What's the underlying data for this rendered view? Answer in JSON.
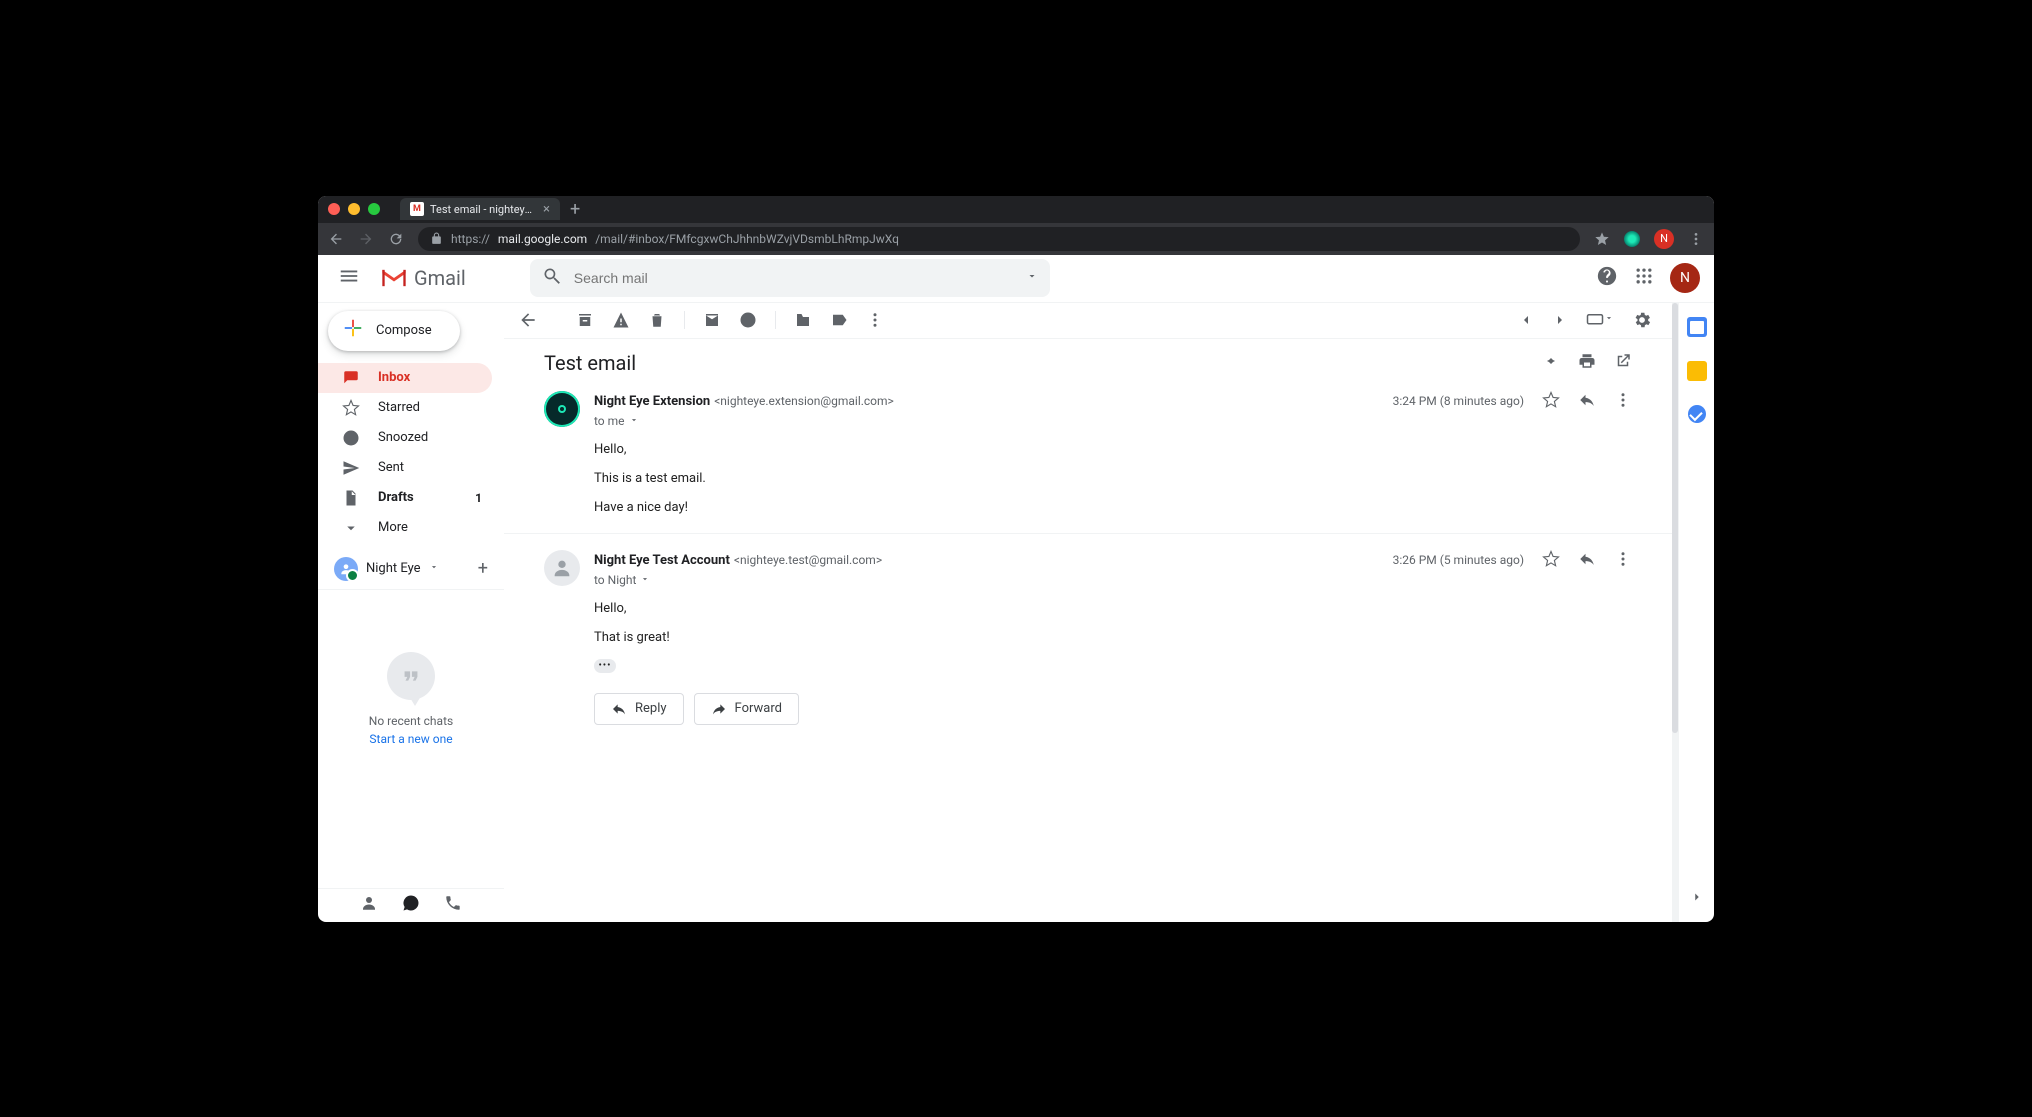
{
  "browser": {
    "tab_title": "Test email - nighteye.test@gm…",
    "url_proto": "https://",
    "url_host": "mail.google.com",
    "url_path": "/mail/#inbox/FMfcgxwChJhhnbWZvjVDsmbLhRmpJwXq",
    "avatar_letter": "N"
  },
  "header": {
    "product": "Gmail",
    "search_placeholder": "Search mail",
    "account_letter": "N"
  },
  "sidebar": {
    "compose": "Compose",
    "items": [
      {
        "label": "Inbox",
        "icon": "inbox"
      },
      {
        "label": "Starred",
        "icon": "star"
      },
      {
        "label": "Snoozed",
        "icon": "clock"
      },
      {
        "label": "Sent",
        "icon": "send"
      },
      {
        "label": "Drafts",
        "icon": "file",
        "count": "1",
        "bold": true
      },
      {
        "label": "More",
        "icon": "chevron"
      }
    ],
    "hangouts_user": "Night Eye",
    "no_recent": "No recent chats",
    "start_new": "Start a new one"
  },
  "thread": {
    "subject": "Test email",
    "messages": [
      {
        "sender_name": "Night Eye Extension",
        "sender_email": "<nighteye.extension@gmail.com>",
        "to": "to me",
        "time": "3:24 PM (8 minutes ago)",
        "body": [
          "Hello,",
          "This is a test email.",
          "Have a nice day!"
        ],
        "avatar": "night"
      },
      {
        "sender_name": "Night Eye Test Account",
        "sender_email": "<nighteye.test@gmail.com>",
        "to": "to Night",
        "time": "3:26 PM (5 minutes ago)",
        "body": [
          "Hello,",
          "That is great!"
        ],
        "avatar": "default",
        "trimmed": true
      }
    ],
    "reply": "Reply",
    "forward": "Forward"
  }
}
